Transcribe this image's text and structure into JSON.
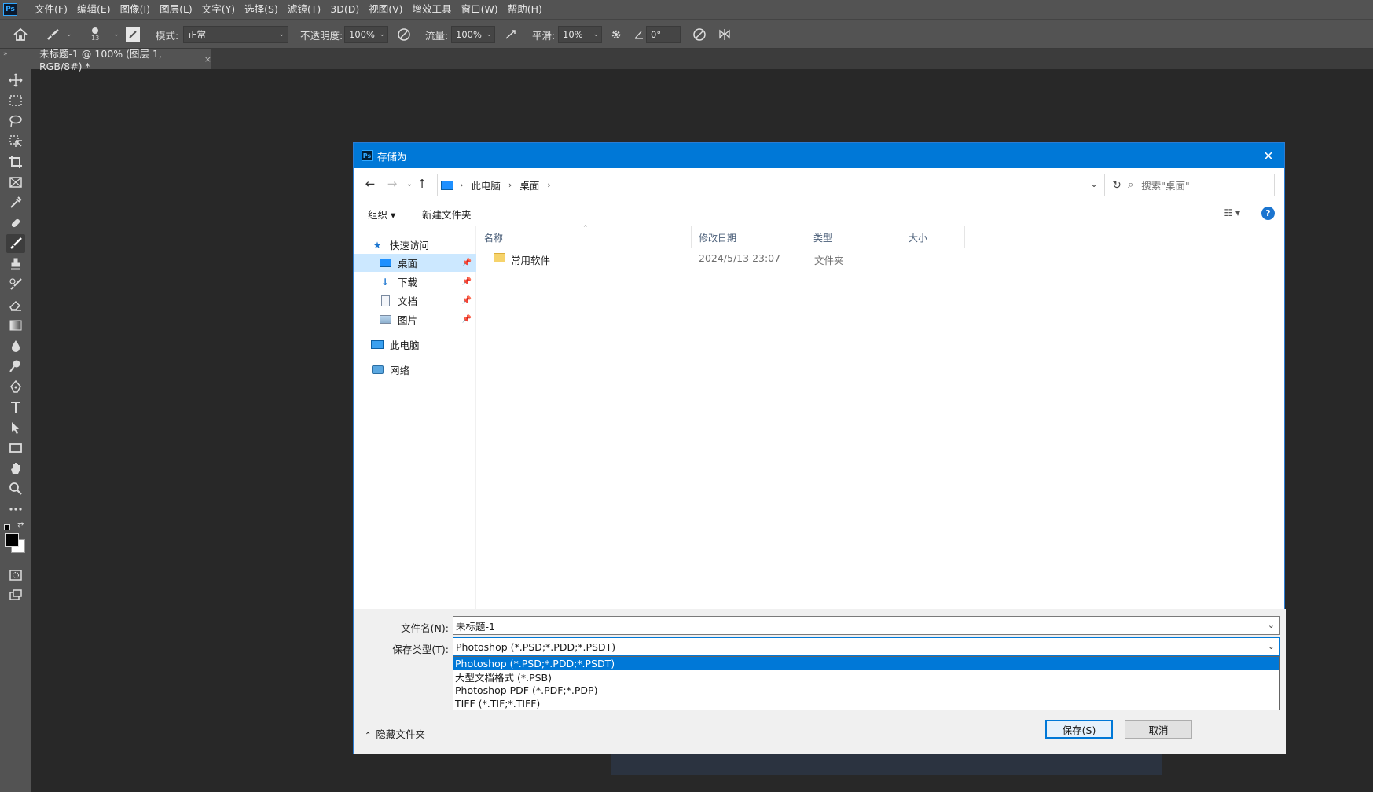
{
  "menubar": {
    "logo": "Ps",
    "items": [
      "文件(F)",
      "编辑(E)",
      "图像(I)",
      "图层(L)",
      "文字(Y)",
      "选择(S)",
      "滤镜(T)",
      "3D(D)",
      "视图(V)",
      "增效工具",
      "窗口(W)",
      "帮助(H)"
    ]
  },
  "options": {
    "brush_size": "13",
    "mode_label": "模式:",
    "mode_value": "正常",
    "opacity_label": "不透明度:",
    "opacity_value": "100%",
    "flow_label": "流量:",
    "flow_value": "100%",
    "smoothing_label": "平滑:",
    "smoothing_value": "10%",
    "angle_value": "0°"
  },
  "document_tab": {
    "title": "未标题-1 @ 100% (图层 1, RGB/8#) *",
    "close": "×"
  },
  "dialog": {
    "title": "存储为",
    "logo": "Ps",
    "close": "✕",
    "breadcrumb": [
      "此电脑",
      "桌面"
    ],
    "search_placeholder": "搜索\"桌面\"",
    "organize": "组织 ▾",
    "new_folder": "新建文件夹",
    "help": "?",
    "sidebar": {
      "quick_access": "快速访问",
      "items": [
        {
          "label": "桌面",
          "icon": "desktop-icon"
        },
        {
          "label": "下载",
          "icon": "download-icon"
        },
        {
          "label": "文档",
          "icon": "document-icon"
        },
        {
          "label": "图片",
          "icon": "picture-icon"
        }
      ],
      "this_pc": "此电脑",
      "network": "网络"
    },
    "columns": [
      "名称",
      "修改日期",
      "类型",
      "大小"
    ],
    "files": [
      {
        "name": "常用软件",
        "modified": "2024/5/13 23:07",
        "type": "文件夹",
        "size": ""
      }
    ],
    "filename_label": "文件名(N):",
    "filename_value": "未标题-1",
    "filetype_label": "保存类型(T):",
    "filetype_value": "Photoshop (*.PSD;*.PDD;*.PSDT)",
    "filetype_options": [
      "Photoshop (*.PSD;*.PDD;*.PSDT)",
      "大型文档格式 (*.PSB)",
      "Photoshop PDF (*.PDF;*.PDP)",
      "TIFF (*.TIF;*.TIFF)"
    ],
    "hide_folders": "隐藏文件夹",
    "save": "保存(S)",
    "cancel": "取消"
  },
  "colors": {
    "accent": "#0078d7",
    "ps_panel": "#535353",
    "workspace": "#282828"
  }
}
